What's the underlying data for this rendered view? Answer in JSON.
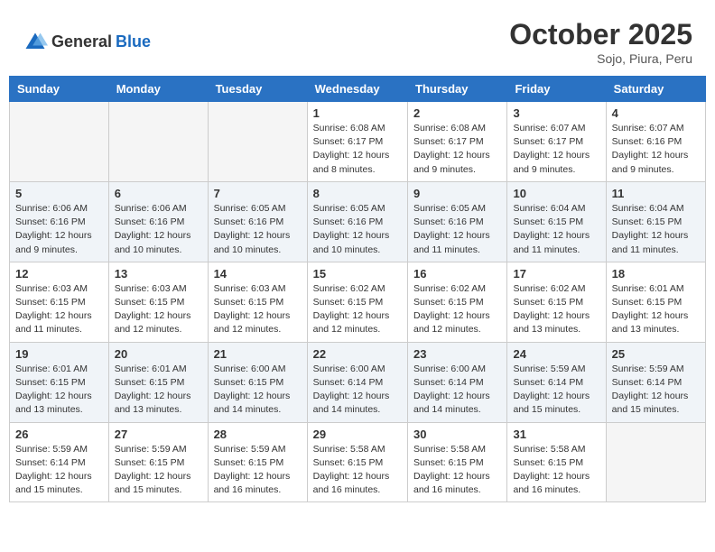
{
  "header": {
    "logo_general": "General",
    "logo_blue": "Blue",
    "month": "October 2025",
    "location": "Sojo, Piura, Peru"
  },
  "days_of_week": [
    "Sunday",
    "Monday",
    "Tuesday",
    "Wednesday",
    "Thursday",
    "Friday",
    "Saturday"
  ],
  "weeks": [
    [
      {
        "day": "",
        "sunrise": "",
        "sunset": "",
        "daylight": "",
        "empty": true
      },
      {
        "day": "",
        "sunrise": "",
        "sunset": "",
        "daylight": "",
        "empty": true
      },
      {
        "day": "",
        "sunrise": "",
        "sunset": "",
        "daylight": "",
        "empty": true
      },
      {
        "day": "1",
        "sunrise": "Sunrise: 6:08 AM",
        "sunset": "Sunset: 6:17 PM",
        "daylight": "Daylight: 12 hours and 8 minutes."
      },
      {
        "day": "2",
        "sunrise": "Sunrise: 6:08 AM",
        "sunset": "Sunset: 6:17 PM",
        "daylight": "Daylight: 12 hours and 9 minutes."
      },
      {
        "day": "3",
        "sunrise": "Sunrise: 6:07 AM",
        "sunset": "Sunset: 6:17 PM",
        "daylight": "Daylight: 12 hours and 9 minutes."
      },
      {
        "day": "4",
        "sunrise": "Sunrise: 6:07 AM",
        "sunset": "Sunset: 6:16 PM",
        "daylight": "Daylight: 12 hours and 9 minutes."
      }
    ],
    [
      {
        "day": "5",
        "sunrise": "Sunrise: 6:06 AM",
        "sunset": "Sunset: 6:16 PM",
        "daylight": "Daylight: 12 hours and 9 minutes."
      },
      {
        "day": "6",
        "sunrise": "Sunrise: 6:06 AM",
        "sunset": "Sunset: 6:16 PM",
        "daylight": "Daylight: 12 hours and 10 minutes."
      },
      {
        "day": "7",
        "sunrise": "Sunrise: 6:05 AM",
        "sunset": "Sunset: 6:16 PM",
        "daylight": "Daylight: 12 hours and 10 minutes."
      },
      {
        "day": "8",
        "sunrise": "Sunrise: 6:05 AM",
        "sunset": "Sunset: 6:16 PM",
        "daylight": "Daylight: 12 hours and 10 minutes."
      },
      {
        "day": "9",
        "sunrise": "Sunrise: 6:05 AM",
        "sunset": "Sunset: 6:16 PM",
        "daylight": "Daylight: 12 hours and 11 minutes."
      },
      {
        "day": "10",
        "sunrise": "Sunrise: 6:04 AM",
        "sunset": "Sunset: 6:15 PM",
        "daylight": "Daylight: 12 hours and 11 minutes."
      },
      {
        "day": "11",
        "sunrise": "Sunrise: 6:04 AM",
        "sunset": "Sunset: 6:15 PM",
        "daylight": "Daylight: 12 hours and 11 minutes."
      }
    ],
    [
      {
        "day": "12",
        "sunrise": "Sunrise: 6:03 AM",
        "sunset": "Sunset: 6:15 PM",
        "daylight": "Daylight: 12 hours and 11 minutes."
      },
      {
        "day": "13",
        "sunrise": "Sunrise: 6:03 AM",
        "sunset": "Sunset: 6:15 PM",
        "daylight": "Daylight: 12 hours and 12 minutes."
      },
      {
        "day": "14",
        "sunrise": "Sunrise: 6:03 AM",
        "sunset": "Sunset: 6:15 PM",
        "daylight": "Daylight: 12 hours and 12 minutes."
      },
      {
        "day": "15",
        "sunrise": "Sunrise: 6:02 AM",
        "sunset": "Sunset: 6:15 PM",
        "daylight": "Daylight: 12 hours and 12 minutes."
      },
      {
        "day": "16",
        "sunrise": "Sunrise: 6:02 AM",
        "sunset": "Sunset: 6:15 PM",
        "daylight": "Daylight: 12 hours and 12 minutes."
      },
      {
        "day": "17",
        "sunrise": "Sunrise: 6:02 AM",
        "sunset": "Sunset: 6:15 PM",
        "daylight": "Daylight: 12 hours and 13 minutes."
      },
      {
        "day": "18",
        "sunrise": "Sunrise: 6:01 AM",
        "sunset": "Sunset: 6:15 PM",
        "daylight": "Daylight: 12 hours and 13 minutes."
      }
    ],
    [
      {
        "day": "19",
        "sunrise": "Sunrise: 6:01 AM",
        "sunset": "Sunset: 6:15 PM",
        "daylight": "Daylight: 12 hours and 13 minutes."
      },
      {
        "day": "20",
        "sunrise": "Sunrise: 6:01 AM",
        "sunset": "Sunset: 6:15 PM",
        "daylight": "Daylight: 12 hours and 13 minutes."
      },
      {
        "day": "21",
        "sunrise": "Sunrise: 6:00 AM",
        "sunset": "Sunset: 6:15 PM",
        "daylight": "Daylight: 12 hours and 14 minutes."
      },
      {
        "day": "22",
        "sunrise": "Sunrise: 6:00 AM",
        "sunset": "Sunset: 6:14 PM",
        "daylight": "Daylight: 12 hours and 14 minutes."
      },
      {
        "day": "23",
        "sunrise": "Sunrise: 6:00 AM",
        "sunset": "Sunset: 6:14 PM",
        "daylight": "Daylight: 12 hours and 14 minutes."
      },
      {
        "day": "24",
        "sunrise": "Sunrise: 5:59 AM",
        "sunset": "Sunset: 6:14 PM",
        "daylight": "Daylight: 12 hours and 15 minutes."
      },
      {
        "day": "25",
        "sunrise": "Sunrise: 5:59 AM",
        "sunset": "Sunset: 6:14 PM",
        "daylight": "Daylight: 12 hours and 15 minutes."
      }
    ],
    [
      {
        "day": "26",
        "sunrise": "Sunrise: 5:59 AM",
        "sunset": "Sunset: 6:14 PM",
        "daylight": "Daylight: 12 hours and 15 minutes."
      },
      {
        "day": "27",
        "sunrise": "Sunrise: 5:59 AM",
        "sunset": "Sunset: 6:15 PM",
        "daylight": "Daylight: 12 hours and 15 minutes."
      },
      {
        "day": "28",
        "sunrise": "Sunrise: 5:59 AM",
        "sunset": "Sunset: 6:15 PM",
        "daylight": "Daylight: 12 hours and 16 minutes."
      },
      {
        "day": "29",
        "sunrise": "Sunrise: 5:58 AM",
        "sunset": "Sunset: 6:15 PM",
        "daylight": "Daylight: 12 hours and 16 minutes."
      },
      {
        "day": "30",
        "sunrise": "Sunrise: 5:58 AM",
        "sunset": "Sunset: 6:15 PM",
        "daylight": "Daylight: 12 hours and 16 minutes."
      },
      {
        "day": "31",
        "sunrise": "Sunrise: 5:58 AM",
        "sunset": "Sunset: 6:15 PM",
        "daylight": "Daylight: 12 hours and 16 minutes."
      },
      {
        "day": "",
        "sunrise": "",
        "sunset": "",
        "daylight": "",
        "empty": true
      }
    ]
  ]
}
